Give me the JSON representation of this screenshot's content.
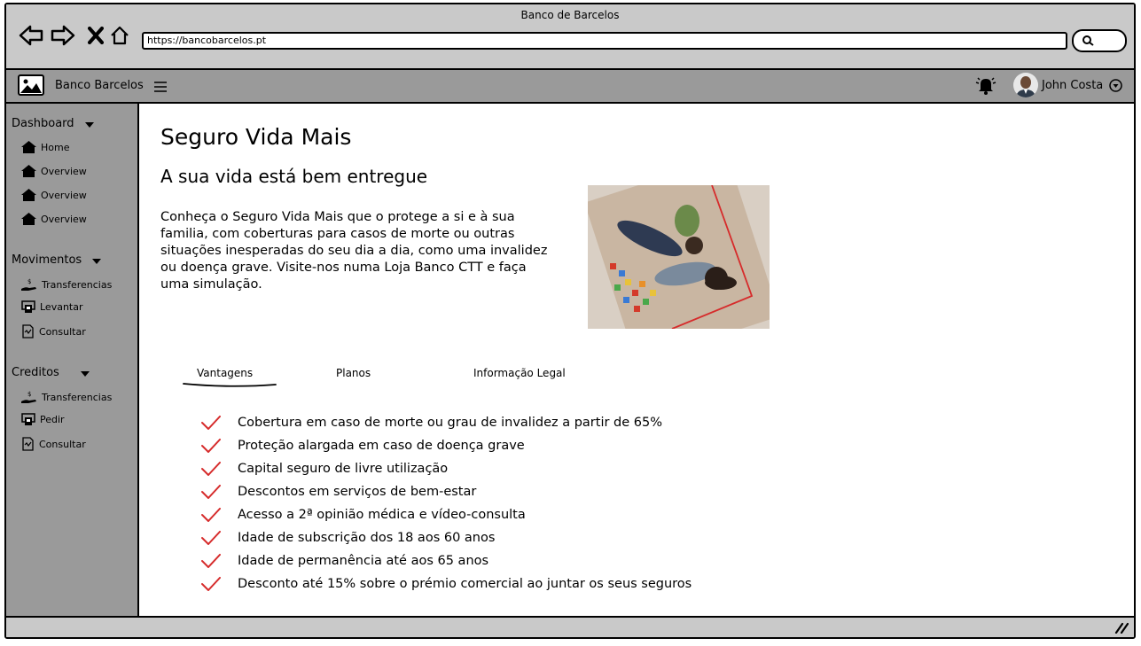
{
  "window": {
    "title": "Banco de Barcelos"
  },
  "browser": {
    "url": "https://bancobarcelos.pt"
  },
  "header": {
    "brand": "Banco Barcelos",
    "user_name": "John Costa"
  },
  "sidebar": {
    "sections": [
      {
        "title": "Dashboard",
        "items": [
          {
            "label": "Home",
            "icon": "home-icon"
          },
          {
            "label": "Overview",
            "icon": "home-icon"
          },
          {
            "label": "Overview",
            "icon": "home-icon"
          },
          {
            "label": "Overview",
            "icon": "home-icon"
          }
        ]
      },
      {
        "title": "Movimentos",
        "items": [
          {
            "label": "Transferencias",
            "icon": "money-hand-icon"
          },
          {
            "label": "Levantar",
            "icon": "atm-icon"
          },
          {
            "label": "Consultar",
            "icon": "document-icon"
          }
        ]
      },
      {
        "title": "Creditos",
        "items": [
          {
            "label": "Transferencias",
            "icon": "money-hand-icon"
          },
          {
            "label": "Pedir",
            "icon": "atm-icon"
          },
          {
            "label": "Consultar",
            "icon": "document-icon"
          }
        ]
      }
    ]
  },
  "main": {
    "title": "Seguro Vida Mais",
    "subtitle": "A sua vida está bem entregue",
    "intro": "Conheça o Seguro Vida Mais que o protege a si e à sua familia, com coberturas para casos de morte ou outras situações inesperadas do seu dia a dia, como uma invalidez ou doença grave. Visite-nos numa Loja Banco CTT e faça uma simulação.",
    "tabs": [
      {
        "label": "Vantagens",
        "active": true
      },
      {
        "label": "Planos",
        "active": false
      },
      {
        "label": "Informação Legal",
        "active": false
      }
    ],
    "benefits": [
      "Cobertura em caso de morte ou grau de invalidez a partir de 65%",
      "Proteção alargada em caso de doença grave",
      "Capital seguro de livre utilização",
      "Descontos em serviços de bem-estar",
      "Acesso a 2ª opinião médica e vídeo-consulta",
      "Idade de subscrição dos 18 aos 60 anos",
      "Idade de permanência até aos 65 anos",
      "Desconto até 15% sobre o prémio comercial ao juntar os seus seguros"
    ]
  },
  "colors": {
    "accent": "#d62b2b",
    "chrome": "#c9c9c9",
    "panel": "#9a9a9a"
  }
}
